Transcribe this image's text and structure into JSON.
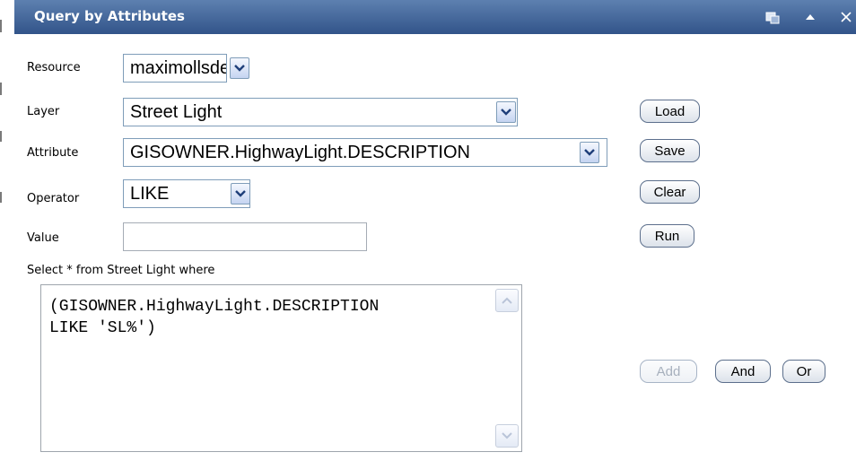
{
  "window": {
    "title": "Query by Attributes",
    "icons": [
      "restore-icon",
      "collapse-icon",
      "close-icon"
    ]
  },
  "form": {
    "resource": {
      "label": "Resource",
      "value": "maximollsde"
    },
    "layer": {
      "label": "Layer",
      "value": "Street Light"
    },
    "attribute": {
      "label": "Attribute",
      "value": "GISOWNER.HighwayLight.DESCRIPTION"
    },
    "operator": {
      "label": "Operator",
      "value": "LIKE"
    },
    "value": {
      "label": "Value",
      "value": ""
    }
  },
  "buttons": {
    "load": "Load",
    "save": "Save",
    "clear": "Clear",
    "run": "Run",
    "add": "Add",
    "and": "And",
    "or": "Or"
  },
  "query": {
    "prefix": "Select * from Street Light where",
    "text": "(GISOWNER.HighwayLight.DESCRIPTION\nLIKE 'SL%')"
  },
  "colors": {
    "titlebar": "#3f6296",
    "field_border": "#7f9db9",
    "disabled_text": "#a7b0bd"
  }
}
